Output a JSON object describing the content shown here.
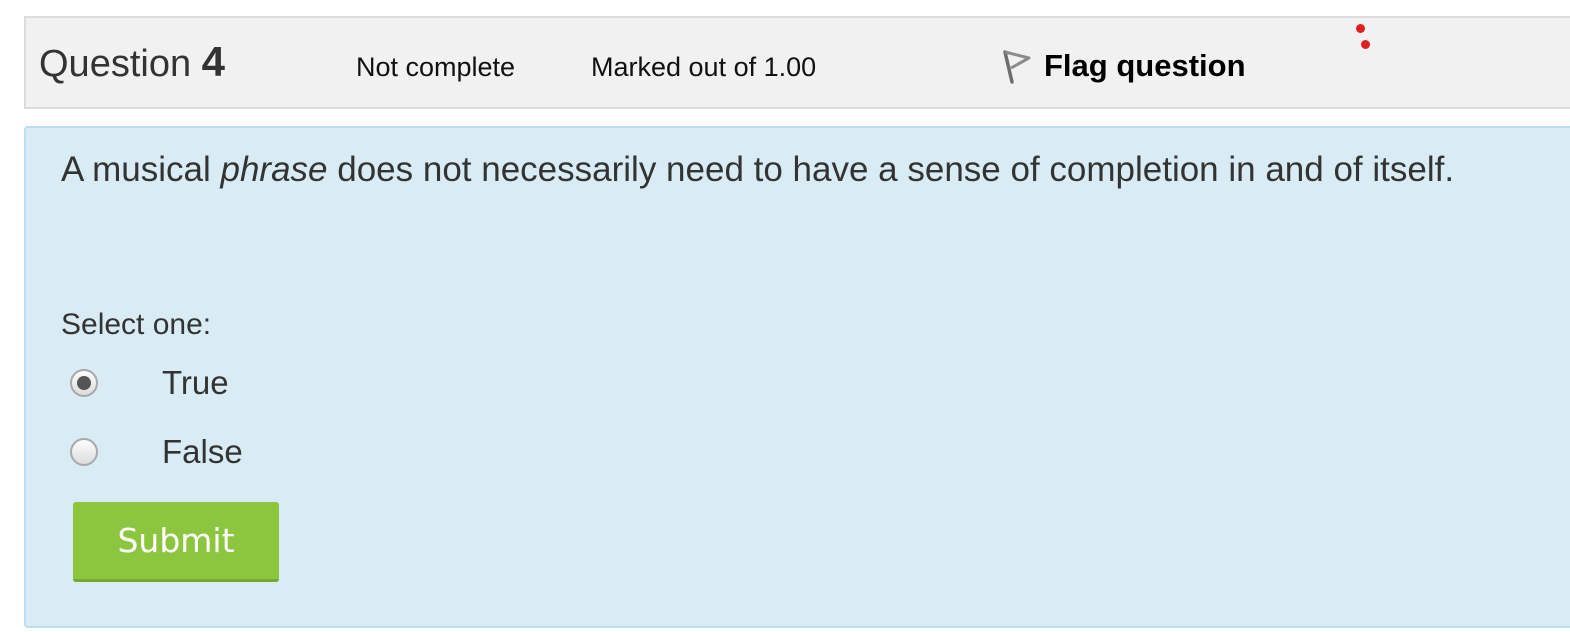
{
  "info": {
    "question_label": "Question",
    "question_number": "4",
    "state": "Not complete",
    "grade": "Marked out of 1.00",
    "flag_label": "Flag question",
    "flag_icon": "flag-icon"
  },
  "question": {
    "text_before": "A musical ",
    "text_emphasis": "phrase",
    "text_after": " does not necessarily need to have a sense of completion in and of itself.",
    "prompt": "Select one:",
    "options": [
      {
        "label": "True",
        "checked": true
      },
      {
        "label": "False",
        "checked": false
      }
    ],
    "submit_label": "Submit"
  },
  "colors": {
    "info_bg": "#f1f1f1",
    "content_bg": "#d9ecf5",
    "submit_bg": "#8cc63f",
    "marker_dots": "#e02020"
  }
}
